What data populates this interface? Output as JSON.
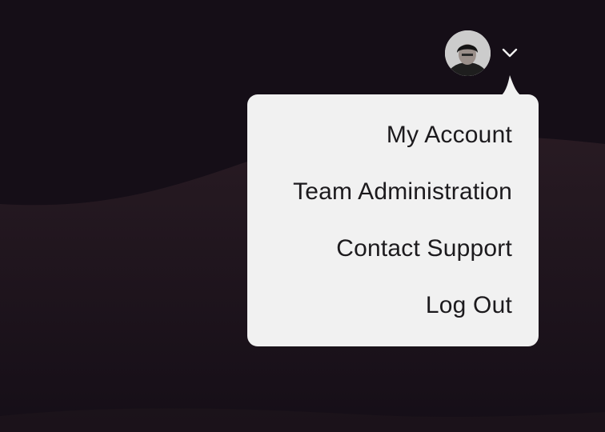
{
  "header": {
    "avatar_icon": "user-avatar",
    "menu_toggle_icon": "chevron-down-icon"
  },
  "account_menu": {
    "items": [
      {
        "label": "My Account"
      },
      {
        "label": "Team Administration"
      },
      {
        "label": "Contact Support"
      },
      {
        "label": "Log Out"
      }
    ]
  },
  "colors": {
    "background": "#150e17",
    "menu_background": "#f1f1f1",
    "menu_text": "#1c1a1d"
  }
}
